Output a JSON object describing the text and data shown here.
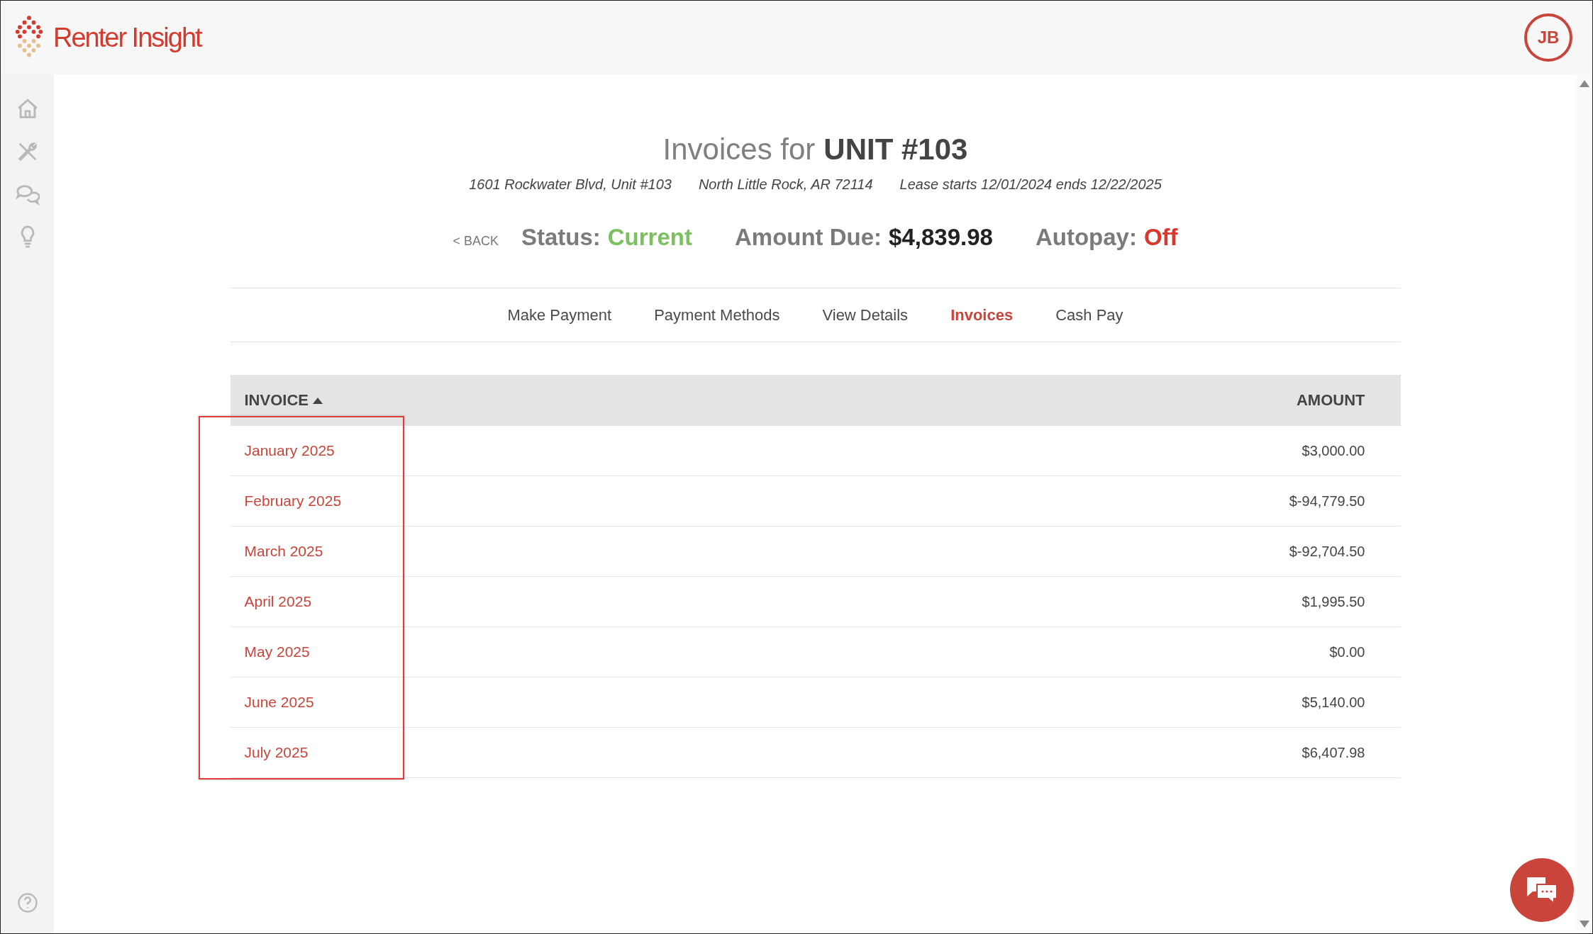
{
  "header": {
    "logo_text": "Renter Insight",
    "user_initials": "JB"
  },
  "sidebar": {
    "items": [
      {
        "kind": "home"
      },
      {
        "kind": "tools"
      },
      {
        "kind": "chat"
      },
      {
        "kind": "idea"
      }
    ]
  },
  "page": {
    "title_prefix": "Invoices for",
    "title_unit": "UNIT #103",
    "address": "1601 Rockwater Blvd, Unit #103",
    "city": "North Little Rock, AR 72114",
    "lease": "Lease starts 12/01/2024 ends 12/22/2025"
  },
  "summary": {
    "back": "< BACK",
    "status_label": "Status:",
    "status_value": "Current",
    "amount_label": "Amount Due:",
    "amount_value": "$4,839.98",
    "autopay_label": "Autopay:",
    "autopay_value": "Off",
    "autopay_on": false
  },
  "tabs": [
    {
      "label": "Make Payment",
      "selected": false
    },
    {
      "label": "Payment Methods",
      "selected": false
    },
    {
      "label": "View Details",
      "selected": false
    },
    {
      "label": "Invoices",
      "selected": true
    },
    {
      "label": "Cash Pay",
      "selected": false
    }
  ],
  "table": {
    "columns": [
      {
        "label": "INVOICE",
        "sort_ascending": true
      },
      {
        "label": "AMOUNT"
      }
    ],
    "invoice_column_highlighted": true,
    "rows": [
      {
        "invoice": "January 2025",
        "amount": "$3,000.00"
      },
      {
        "invoice": "February 2025",
        "amount": "$-94,779.50"
      },
      {
        "invoice": "March 2025",
        "amount": "$-92,704.50"
      },
      {
        "invoice": "April 2025",
        "amount": "$1,995.50"
      },
      {
        "invoice": "May 2025",
        "amount": "$0.00"
      },
      {
        "invoice": "June 2025",
        "amount": "$5,140.00"
      },
      {
        "invoice": "July 2025",
        "amount": "$6,407.98"
      }
    ]
  }
}
